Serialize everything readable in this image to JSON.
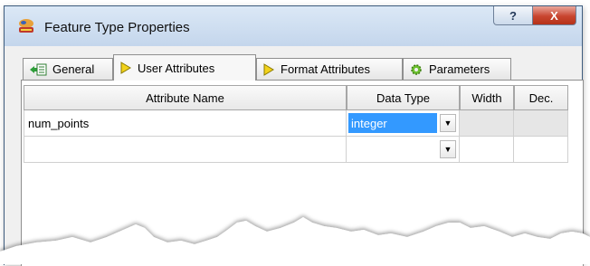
{
  "window": {
    "title": "Feature Type Properties",
    "help_glyph": "?",
    "close_glyph": "X"
  },
  "tabs": [
    {
      "label": "General",
      "icon": "general-icon",
      "active": false
    },
    {
      "label": "User Attributes",
      "icon": "diamond-arrow-icon",
      "active": true
    },
    {
      "label": "Format Attributes",
      "icon": "diamond-arrow-icon",
      "active": false
    },
    {
      "label": "Parameters",
      "icon": "gear-icon",
      "active": false
    }
  ],
  "table": {
    "headers": [
      "Attribute Name",
      "Data Type",
      "Width",
      "Dec."
    ],
    "rows": [
      {
        "name": "num_points",
        "data_type": "integer",
        "width": "",
        "dec": ""
      },
      {
        "name": "",
        "data_type": "",
        "width": "",
        "dec": ""
      }
    ]
  },
  "colors": {
    "selection": "#3399ff",
    "close_button": "#c8452f",
    "title_bar": "#c4d6ec"
  }
}
